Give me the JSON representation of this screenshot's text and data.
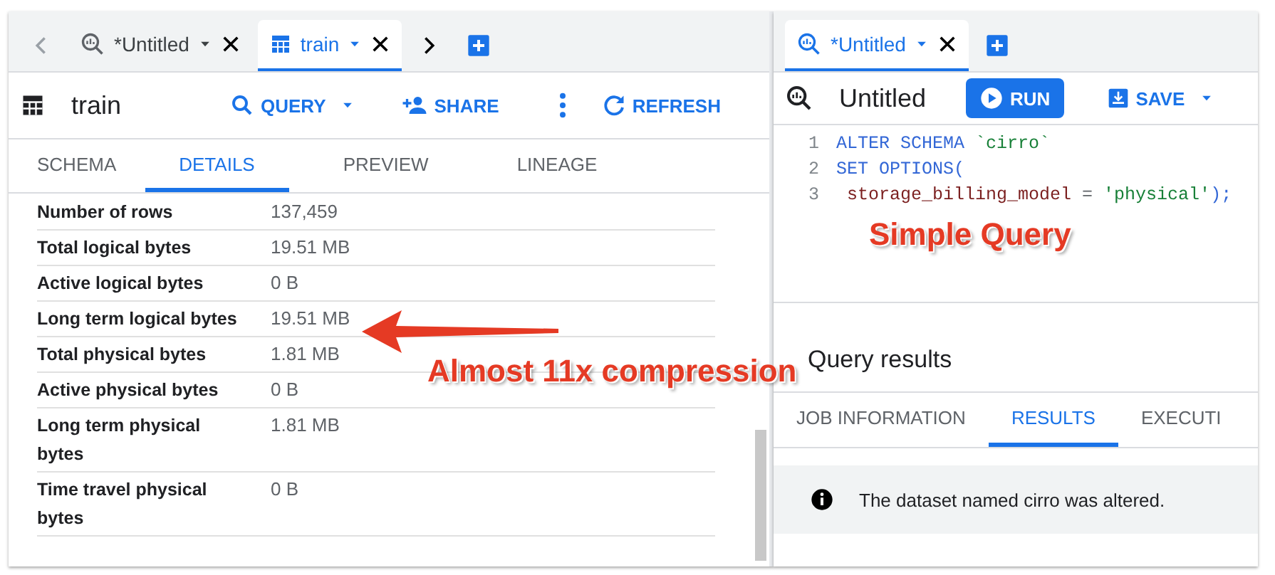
{
  "left_pane": {
    "tabs": [
      {
        "kind": "query",
        "label": "*Untitled",
        "selected": false
      },
      {
        "kind": "table",
        "label": "train",
        "selected": true
      }
    ],
    "toolbar": {
      "title": "train",
      "actions": [
        {
          "kind": "query",
          "label": "QUERY"
        },
        {
          "kind": "share",
          "label": "SHARE"
        },
        {
          "kind": "more"
        },
        {
          "kind": "refresh",
          "label": "REFRESH"
        }
      ]
    },
    "subtabs": [
      {
        "label": "SCHEMA",
        "selected": false
      },
      {
        "label": "DETAILS",
        "selected": true
      },
      {
        "label": "PREVIEW",
        "selected": false
      },
      {
        "label": "LINEAGE",
        "selected": false
      }
    ],
    "details": [
      {
        "label": "Number of rows",
        "value": "137,459"
      },
      {
        "label": "Total logical bytes",
        "value": "19.51 MB"
      },
      {
        "label": "Active logical bytes",
        "value": "0 B"
      },
      {
        "label": "Long term logical bytes",
        "value": "19.51 MB"
      },
      {
        "label": "Total physical bytes",
        "value": "1.81 MB"
      },
      {
        "label": "Active physical bytes",
        "value": "0 B"
      },
      {
        "label": "Long term physical bytes",
        "value": "1.81 MB"
      },
      {
        "label": "Time travel physical bytes",
        "value": "0 B"
      }
    ]
  },
  "right_pane": {
    "tabs": [
      {
        "kind": "query",
        "label": "*Untitled",
        "selected": true
      }
    ],
    "toolbar": {
      "title": "Untitled",
      "run": "RUN",
      "save": "SAVE"
    },
    "editor": {
      "lines": [
        {
          "number": "1",
          "tokens": [
            {
              "kind": "keyword",
              "text": "ALTER SCHEMA "
            },
            {
              "kind": "string",
              "text": "`cirro`"
            }
          ]
        },
        {
          "number": "2",
          "tokens": [
            {
              "kind": "keyword",
              "text": "SET OPTIONS("
            }
          ]
        },
        {
          "number": "3",
          "tokens": [
            {
              "kind": "identifier",
              "text": " storage_billing_model"
            },
            {
              "kind": "operator",
              "text": " = "
            },
            {
              "kind": "string",
              "text": "'physical'"
            },
            {
              "kind": "keyword",
              "text": ");"
            }
          ]
        }
      ]
    },
    "results": {
      "title": "Query results",
      "tabs": [
        {
          "label": "JOB INFORMATION",
          "selected": false
        },
        {
          "label": "RESULTS",
          "selected": true
        },
        {
          "label": "EXECUTI",
          "selected": false
        }
      ],
      "message": "The dataset named cirro was altered."
    }
  },
  "annotations": [
    {
      "kind": "label",
      "text": "Simple Query"
    },
    {
      "kind": "arrow-label",
      "text": "Almost 11x compression"
    }
  ]
}
